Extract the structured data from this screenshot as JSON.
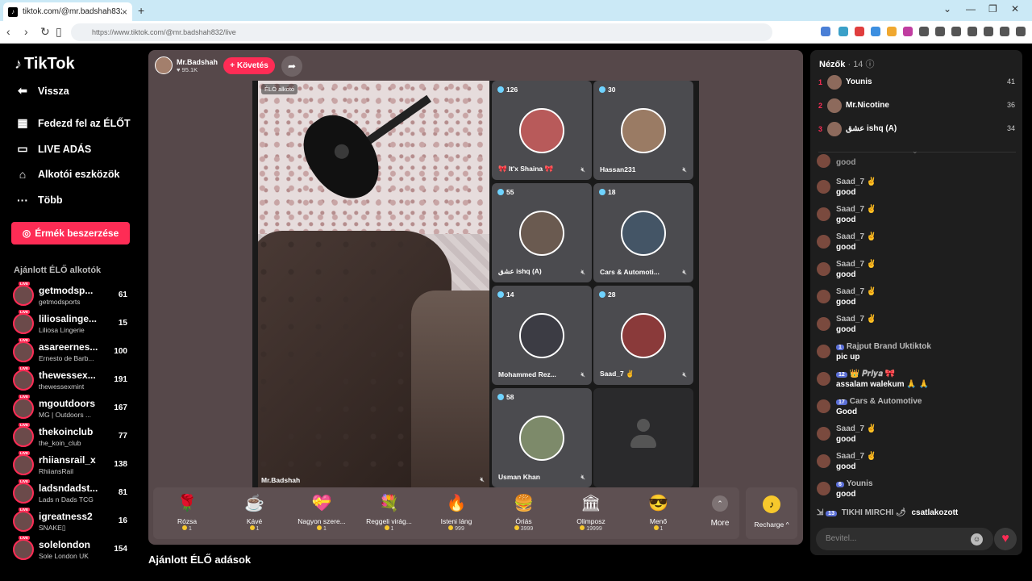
{
  "browser": {
    "tab_title": "tiktok.com/@mr.badshah832",
    "url": "https://www.tiktok.com/@mr.badshah832/live"
  },
  "sidebar": {
    "logo": "TikTok",
    "back": "Vissza",
    "nav": [
      {
        "label": "Fedezd fel az ÉLŐT",
        "icon": "calendar-icon"
      },
      {
        "label": "LIVE ADÁS",
        "icon": "camera-icon"
      },
      {
        "label": "Alkotói eszközök",
        "icon": "home-icon"
      },
      {
        "label": "Több",
        "icon": "more-dots-icon"
      }
    ],
    "coins_button": "Érmék beszerzése",
    "recommended_title": "Ajánlott ÉLŐ alkotók",
    "creators": [
      {
        "name": "getmodsp...",
        "sub": "getmodsports",
        "count": "61"
      },
      {
        "name": "liliosalinge...",
        "sub": "Liliosa Lingerie",
        "count": "15"
      },
      {
        "name": "asareernes...",
        "sub": "Ernesto de Barb...",
        "count": "100"
      },
      {
        "name": "thewessex...",
        "sub": "thewessexmint",
        "count": "191"
      },
      {
        "name": "mgoutdoors",
        "sub": "MG | Outdoors ...",
        "count": "167"
      },
      {
        "name": "thekoinclub",
        "sub": "the_koin_club",
        "count": "77"
      },
      {
        "name": "rhiiansrail_x",
        "sub": "RhiiansRail",
        "count": "138"
      },
      {
        "name": "ladsndadst...",
        "sub": "Lads n Dads TCG",
        "count": "81"
      },
      {
        "name": "igreatness2",
        "sub": "SNAKE▯",
        "count": "16"
      },
      {
        "name": "solelondon",
        "sub": "Sole London UK",
        "count": "154"
      }
    ],
    "live_badge": "LIVE"
  },
  "stage": {
    "host_name": "Mr.Badshah",
    "host_likes": "95.1K",
    "follow_label": "+ Követés",
    "main_label": "ÉLŐ alkotó",
    "main_name": "Mr.Badshah",
    "guests": [
      {
        "viewers": "126",
        "name": "🎀 It'x Shaina 🎀",
        "avatar_color": "#b85a5a"
      },
      {
        "viewers": "30",
        "name": "Hassan231",
        "avatar_color": "#9a7b64"
      },
      {
        "viewers": "55",
        "name": "عشق ishq (A)",
        "avatar_color": "#6a5a50"
      },
      {
        "viewers": "18",
        "name": "Cars & Automoti...",
        "avatar_color": "#445566"
      },
      {
        "viewers": "14",
        "name": "Mohammed Rez...",
        "avatar_color": "#3c3c44"
      },
      {
        "viewers": "28",
        "name": "Saad_7 ✌",
        "avatar_color": "#8a3a3a"
      },
      {
        "viewers": "58",
        "name": "Usman Khan",
        "avatar_color": "#7d8a6a"
      }
    ],
    "gifts": [
      {
        "name": "Rózsa",
        "price": "1",
        "emoji": "🌹"
      },
      {
        "name": "Kávé",
        "price": "1",
        "emoji": "☕"
      },
      {
        "name": "Nagyon szere...",
        "price": "1",
        "emoji": "💝"
      },
      {
        "name": "Reggeli virág...",
        "price": "1",
        "emoji": "💐"
      },
      {
        "name": "Isteni láng",
        "price": "999",
        "emoji": "🔥"
      },
      {
        "name": "Óriás",
        "price": "3999",
        "emoji": "🍔"
      },
      {
        "name": "Olimposz",
        "price": "19999",
        "emoji": "🏛"
      },
      {
        "name": "Menő",
        "price": "1",
        "emoji": "😎"
      }
    ],
    "more_label": "More",
    "recharge_label": "Recharge ^",
    "recommended_lives": "Ajánlott ÉLŐ adások"
  },
  "panel": {
    "viewers_title": "Nézők",
    "viewers_count": "· 14",
    "top_viewers": [
      {
        "rank": "1",
        "name": "Younis",
        "score": "41"
      },
      {
        "rank": "2",
        "name": "Mr.Nicotine",
        "score": "36"
      },
      {
        "rank": "3",
        "name": "عشق ishq (A)",
        "score": "34"
      }
    ],
    "messages": [
      {
        "who": "",
        "text": "good"
      },
      {
        "who": "Saad_7 ✌",
        "text": "good"
      },
      {
        "who": "Saad_7 ✌",
        "text": "good"
      },
      {
        "who": "Saad_7 ✌",
        "text": "good"
      },
      {
        "who": "Saad_7 ✌",
        "text": "good"
      },
      {
        "who": "Saad_7 ✌",
        "text": "good"
      },
      {
        "who": "Saad_7 ✌",
        "text": "good"
      },
      {
        "who": "Rajput Brand Uktiktok",
        "level": "1",
        "text": "pic up"
      },
      {
        "who": "👑 𝑷𝒓𝒊𝒚𝒂 🎀",
        "level": "12",
        "text": "assalam walekum 🙏 🙏"
      },
      {
        "who": "Cars & Automotive",
        "level": "17",
        "text": "Good"
      },
      {
        "who": "Saad_7 ✌",
        "text": "good"
      },
      {
        "who": "Saad_7 ✌",
        "text": "good"
      },
      {
        "who": "Younis",
        "level": "6",
        "text": "good"
      }
    ],
    "join_level": "13",
    "join_name": "TIKHI MIRCHI 🌶",
    "join_text": "csatlakozott",
    "input_placeholder": "Bevitel..."
  }
}
